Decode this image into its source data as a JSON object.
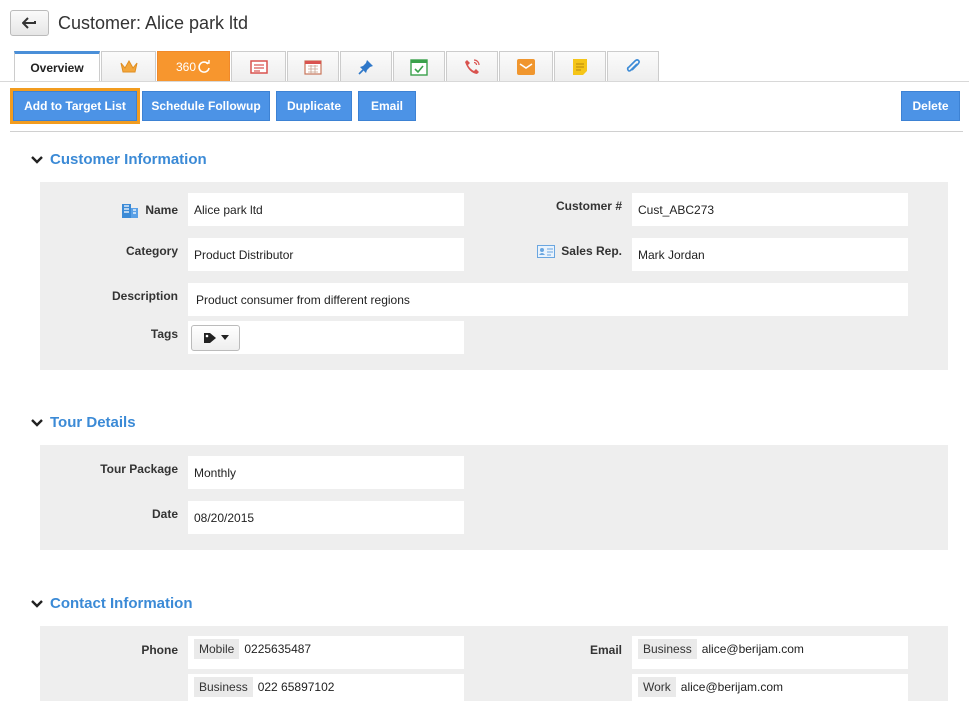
{
  "header": {
    "title": "Customer: Alice park ltd"
  },
  "tabs": [
    {
      "label": "Overview",
      "icon": "overview"
    },
    {
      "label": "",
      "icon": "crown-icon"
    },
    {
      "label": "360",
      "icon": "refresh-icon"
    },
    {
      "label": "",
      "icon": "list-card-icon"
    },
    {
      "label": "",
      "icon": "calendar-icon"
    },
    {
      "label": "",
      "icon": "pin-icon"
    },
    {
      "label": "",
      "icon": "calendar-check-icon"
    },
    {
      "label": "",
      "icon": "phone-icon"
    },
    {
      "label": "",
      "icon": "mail-icon"
    },
    {
      "label": "",
      "icon": "note-icon"
    },
    {
      "label": "",
      "icon": "paperclip-icon"
    }
  ],
  "actions": {
    "add_target": "Add to Target List",
    "schedule": "Schedule Followup",
    "duplicate": "Duplicate",
    "email": "Email",
    "delete": "Delete"
  },
  "customer_info": {
    "title": "Customer Information",
    "name_label": "Name",
    "name": "Alice park ltd",
    "number_label": "Customer #",
    "number": "Cust_ABC273",
    "category_label": "Category",
    "category": "Product Distributor",
    "salesrep_label": "Sales Rep.",
    "salesrep": "Mark Jordan",
    "description_label": "Description",
    "description": "Product consumer from different regions",
    "tags_label": "Tags"
  },
  "tour_details": {
    "title": "Tour Details",
    "package_label": "Tour Package",
    "package": "Monthly",
    "date_label": "Date",
    "date": "08/20/2015"
  },
  "contact_info": {
    "title": "Contact Information",
    "phone_label": "Phone",
    "phones": [
      {
        "type": "Mobile",
        "value": "0225635487"
      },
      {
        "type": "Business",
        "value": "022 65897102"
      }
    ],
    "email_label": "Email",
    "emails": [
      {
        "type": "Business",
        "value": "alice@berijam.com"
      },
      {
        "type": "Work",
        "value": "alice@berijam.com"
      }
    ]
  },
  "colors": {
    "accent": "#4c93e6",
    "section_title": "#3b8ad6",
    "focus": "#f29c1f",
    "tab_orange": "#f7962e"
  }
}
